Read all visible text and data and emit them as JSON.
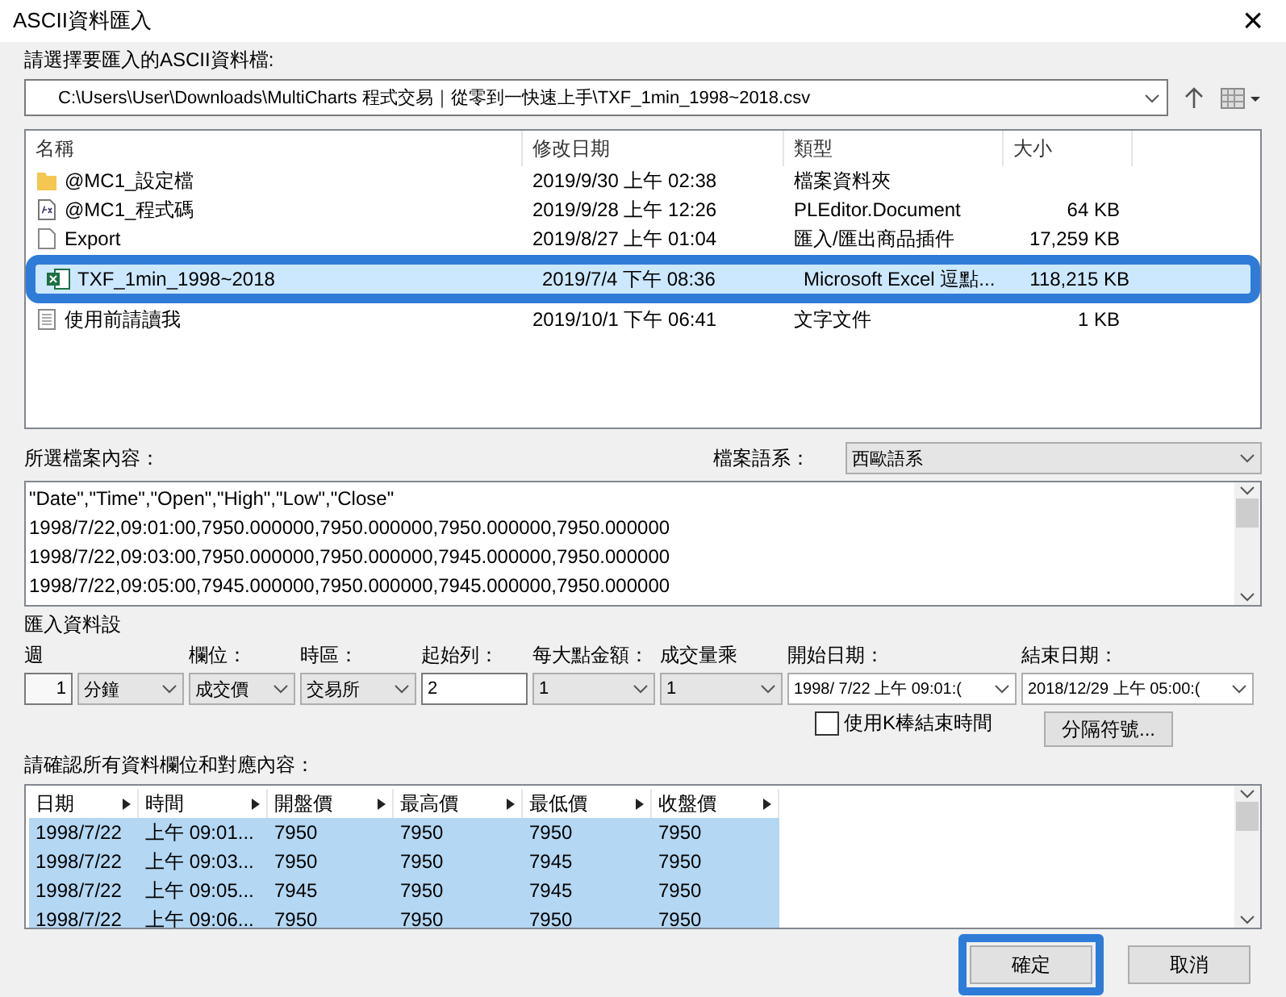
{
  "window": {
    "title": "ASCII資料匯入",
    "close": "×"
  },
  "path_label": "請選擇要匯入的ASCII資料檔:",
  "path": {
    "value": "C:\\Users\\User\\Downloads\\MultiCharts 程式交易｜從零到一快速上手\\TXF_1min_1998~2018.csv"
  },
  "file_list": {
    "columns": [
      {
        "label": "名稱"
      },
      {
        "label": "修改日期"
      },
      {
        "label": "類型"
      },
      {
        "label": "大小"
      }
    ],
    "rows": [
      {
        "kind": "folder",
        "name": "@MC1_設定檔",
        "date": "2019/9/30 上午 02:38",
        "type": "檔案資料夾",
        "selected": false
      },
      {
        "kind": "code",
        "name": "@MC1_程式碼",
        "date": "2019/9/28 上午 12:26",
        "type": "PLEditor.Document",
        "size": "64 KB",
        "selected": false
      },
      {
        "kind": "file",
        "name": "Export",
        "date": "2019/8/27 上午 01:04",
        "type": "匯入/匯出商品插件",
        "size": "17,259 KB",
        "selected": false
      },
      {
        "kind": "excel",
        "name": "TXF_1min_1998~2018",
        "date": "2019/7/4 下午 08:36",
        "type": "Microsoft Excel 逗點...",
        "size": "118,215 KB",
        "selected": true
      },
      {
        "kind": "text",
        "name": "使用前請讀我",
        "date": "2019/10/1 下午 06:41",
        "type": "文字文件",
        "size": "1 KB",
        "selected": false
      }
    ]
  },
  "content_label": "所選檔案內容：",
  "encoding": {
    "label": "檔案語系：",
    "value": "西歐語系"
  },
  "content_lines": [
    "\"Date\",\"Time\",\"Open\",\"High\",\"Low\",\"Close\"",
    "1998/7/22,09:01:00,7950.000000,7950.000000,7950.000000,7950.000000",
    "1998/7/22,09:03:00,7950.000000,7950.000000,7945.000000,7950.000000",
    "1998/7/22,09:05:00,7945.000000,7950.000000,7945.000000,7950.000000"
  ],
  "settings_label": "匯入資料設",
  "settings": [
    {
      "kind": "spin",
      "label": "週",
      "value": "1"
    },
    {
      "kind": "select",
      "value": "分鐘"
    },
    {
      "kind": "select",
      "label": "欄位：",
      "value": "成交價"
    },
    {
      "kind": "select",
      "label": "時區：",
      "value": "交易所"
    },
    {
      "kind": "input",
      "label": "起始列：",
      "value": "2"
    },
    {
      "kind": "select",
      "label": "每大點金額：",
      "value": "1"
    },
    {
      "kind": "select",
      "label": "成交量乘",
      "value": "1"
    },
    {
      "kind": "date",
      "label": "開始日期：",
      "value": "1998/  7/22 上午 09:01:("
    },
    {
      "kind": "date",
      "label": "結束日期：",
      "value": "2018/12/29 上午 05:00:("
    }
  ],
  "use_bar_end_time": {
    "label": "使用K棒結束時間",
    "checked": false
  },
  "separator_button": "分隔符號...",
  "grid_label": "請確認所有資料欄位和對應內容：",
  "grid": {
    "columns": [
      {
        "label": "日期"
      },
      {
        "label": "時間"
      },
      {
        "label": "開盤價"
      },
      {
        "label": "最高價"
      },
      {
        "label": "最低價"
      },
      {
        "label": "收盤價"
      }
    ],
    "rows": [
      {
        "cells": [
          "1998/7/22",
          "上午 09:01...",
          "7950",
          "7950",
          "7950",
          "7950"
        ],
        "selected": true
      },
      {
        "cells": [
          "1998/7/22",
          "上午 09:03...",
          "7950",
          "7950",
          "7945",
          "7950"
        ],
        "selected": true
      },
      {
        "cells": [
          "1998/7/22",
          "上午 09:05...",
          "7945",
          "7950",
          "7945",
          "7950"
        ],
        "selected": true
      },
      {
        "cells": [
          "1998/7/22",
          "上午 09:06...",
          "7950",
          "7950",
          "7950",
          "7950"
        ],
        "selected": true
      }
    ]
  },
  "buttons": [
    {
      "label": "確定",
      "highlighted": true
    },
    {
      "label": "取消",
      "highlighted": false
    }
  ]
}
